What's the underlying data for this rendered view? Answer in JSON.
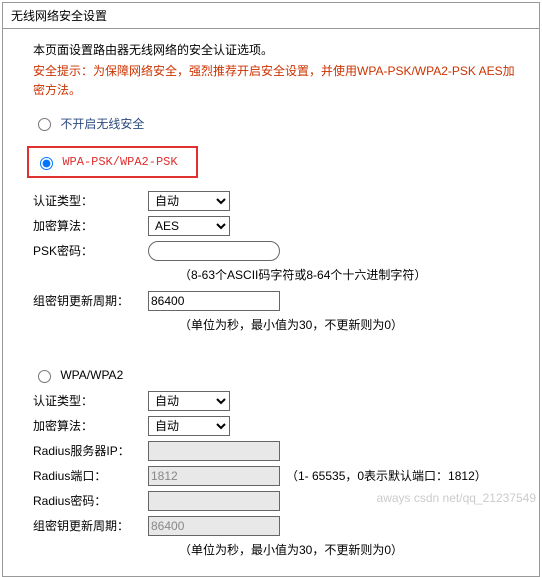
{
  "title": "无线网络安全设置",
  "desc": "本页面设置路由器无线网络的安全认证选项。",
  "warn": "安全提示：为保障网络安全，强烈推荐开启安全设置，并使用WPA-PSK/WPA2-PSK AES加密方法。",
  "option_disable": "不开启无线安全",
  "option_psk": "WPA-PSK/WPA2-PSK",
  "option_wpa": "WPA/WPA2",
  "labels": {
    "auth_type": "认证类型：",
    "encryption": "加密算法：",
    "psk_password": "PSK密码：",
    "group_rekey": "组密钥更新周期：",
    "radius_ip": "Radius服务器IP：",
    "radius_port": "Radius端口：",
    "radius_pw": "Radius密码："
  },
  "psk": {
    "auth_type": "自动",
    "encryption": "AES",
    "password": "",
    "password_hint": "（8-63个ASCII码字符或8-64个十六进制字符）",
    "group_rekey": "86400",
    "group_rekey_hint": "（单位为秒，最小值为30，不更新则为0）"
  },
  "wpa": {
    "auth_type": "自动",
    "encryption": "自动",
    "radius_ip": "",
    "radius_port": "1812",
    "radius_port_hint": "（1- 65535，0表示默认端口：1812）",
    "radius_pw": "",
    "group_rekey": "86400",
    "group_rekey_hint": "（单位为秒，最小值为30，不更新则为0）"
  },
  "watermark": "aways csdn net/qq_21237549"
}
